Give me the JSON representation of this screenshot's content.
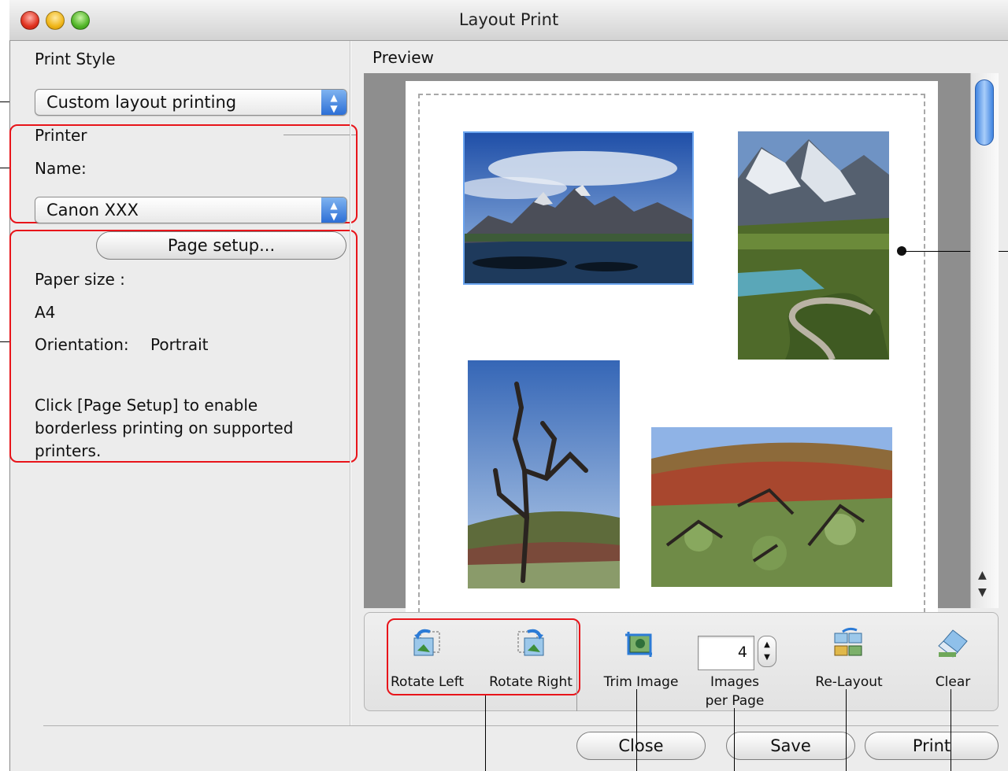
{
  "window": {
    "title": "Layout Print"
  },
  "left_panel": {
    "print_style_label": "Print Style",
    "print_style_value": "Custom layout printing",
    "printer_label": "Printer",
    "name_label": "Name:",
    "printer_value": "Canon XXX",
    "page_setup_button": "Page setup...",
    "paper_size_label": "Paper size :",
    "paper_size_value": "A4",
    "orientation_label": "Orientation:",
    "orientation_value": "Portrait",
    "hint_line1": "Click [Page Setup] to enable",
    "hint_line2": "borderless printing on supported",
    "hint_line3": "printers."
  },
  "preview": {
    "label": "Preview"
  },
  "toolbar": {
    "rotate_left": "Rotate Left",
    "rotate_right": "Rotate Right",
    "trim_image": "Trim Image",
    "images_per_page_value": "4",
    "images_per_page_line1": "Images",
    "images_per_page_line2": "per Page",
    "re_layout": "Re-Layout",
    "clear": "Clear"
  },
  "buttons": {
    "close": "Close",
    "save": "Save",
    "print": "Print"
  },
  "colors": {
    "annotation_red": "#e8141a",
    "scroll_blue": "#3f84e0"
  }
}
